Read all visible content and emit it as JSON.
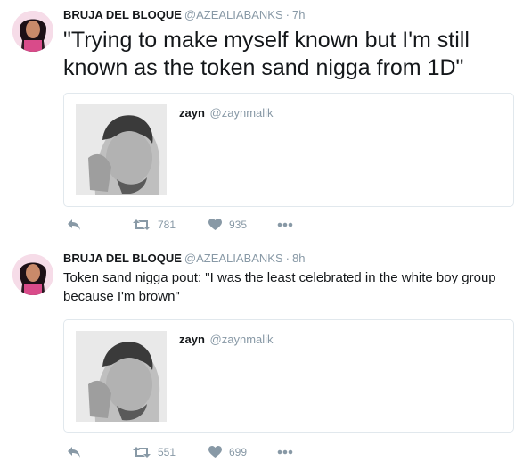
{
  "tweets": [
    {
      "author_name": "BRUJA DEL BLOQUE",
      "author_handle": "@AZEALIABANKS",
      "separator": "·",
      "time": "7h",
      "text": "\"Trying to make myself known but I'm still known as the token sand nigga from  1D\"",
      "quoted": {
        "name": "zayn",
        "handle": "@zaynmalik"
      },
      "retweets": "781",
      "likes": "935"
    },
    {
      "author_name": "BRUJA DEL BLOQUE",
      "author_handle": "@AZEALIABANKS",
      "separator": "·",
      "time": "8h",
      "text": "Token sand nigga pout: \"I was the least celebrated in the white boy group because I'm brown\"",
      "quoted": {
        "name": "zayn",
        "handle": "@zaynmalik"
      },
      "retweets": "551",
      "likes": "699"
    }
  ],
  "icons": {
    "reply": "reply-arrow-icon",
    "retweet": "retweet-icon",
    "like": "heart-icon",
    "more": "more-dots-icon"
  },
  "colors": {
    "text": "#14171a",
    "muted": "#8899a6",
    "border": "#e1e8ed"
  }
}
